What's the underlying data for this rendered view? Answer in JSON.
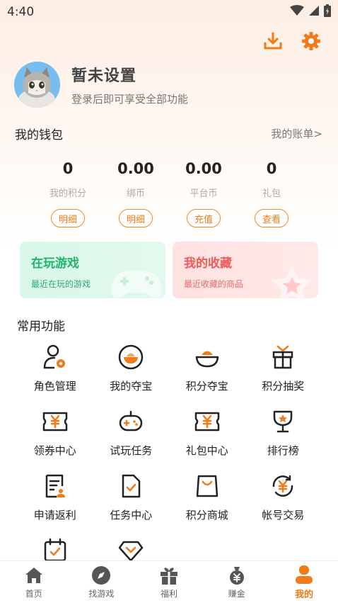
{
  "status_bar": {
    "time": "4:40"
  },
  "colors": {
    "accent": "#f07b18",
    "icon_dark": "#222222",
    "green": "#1fb36b",
    "pink": "#f05a5a"
  },
  "top_actions": {
    "icons": [
      "download-icon",
      "gear-icon"
    ]
  },
  "profile": {
    "name": "暂未设置",
    "subtitle": "登录后即可享受全部功能"
  },
  "wallet": {
    "title": "我的钱包",
    "link": "我的账单>",
    "items": [
      {
        "value": "0",
        "label": "我的积分",
        "button": "明细"
      },
      {
        "value": "0.00",
        "label": "绑币",
        "button": "明细"
      },
      {
        "value": "0.00",
        "label": "平台币",
        "button": "充值"
      },
      {
        "value": "0",
        "label": "礼包",
        "button": "查看"
      }
    ]
  },
  "cards": [
    {
      "title": "在玩游戏",
      "subtitle": "最近在玩的游戏"
    },
    {
      "title": "我的收藏",
      "subtitle": "最近收藏的商品"
    }
  ],
  "functions": {
    "title": "常用功能",
    "items": [
      {
        "label": "角色管理",
        "icon": "role-manage-icon"
      },
      {
        "label": "我的夺宝",
        "icon": "treasure-icon"
      },
      {
        "label": "积分夺宝",
        "icon": "points-treasure-icon"
      },
      {
        "label": "积分抽奖",
        "icon": "gift-lottery-icon"
      },
      {
        "label": "领券中心",
        "icon": "coupon-icon"
      },
      {
        "label": "试玩任务",
        "icon": "gamepad-icon"
      },
      {
        "label": "礼包中心",
        "icon": "gift-pack-icon"
      },
      {
        "label": "排行榜",
        "icon": "trophy-icon"
      },
      {
        "label": "申请返利",
        "icon": "rebate-doc-icon"
      },
      {
        "label": "任务中心",
        "icon": "task-doc-icon"
      },
      {
        "label": "积分商城",
        "icon": "shopping-bag-icon"
      },
      {
        "label": "帐号交易",
        "icon": "trade-cycle-icon"
      },
      {
        "label": "",
        "icon": "calendar-check-icon"
      },
      {
        "label": "",
        "icon": "diamond-check-icon"
      }
    ]
  },
  "bottom_nav": [
    {
      "label": "首页",
      "icon": "home-icon"
    },
    {
      "label": "找游戏",
      "icon": "compass-icon"
    },
    {
      "label": "福利",
      "icon": "gift-icon"
    },
    {
      "label": "赚金",
      "icon": "money-bag-icon"
    },
    {
      "label": "我的",
      "icon": "user-icon",
      "active": true
    }
  ]
}
